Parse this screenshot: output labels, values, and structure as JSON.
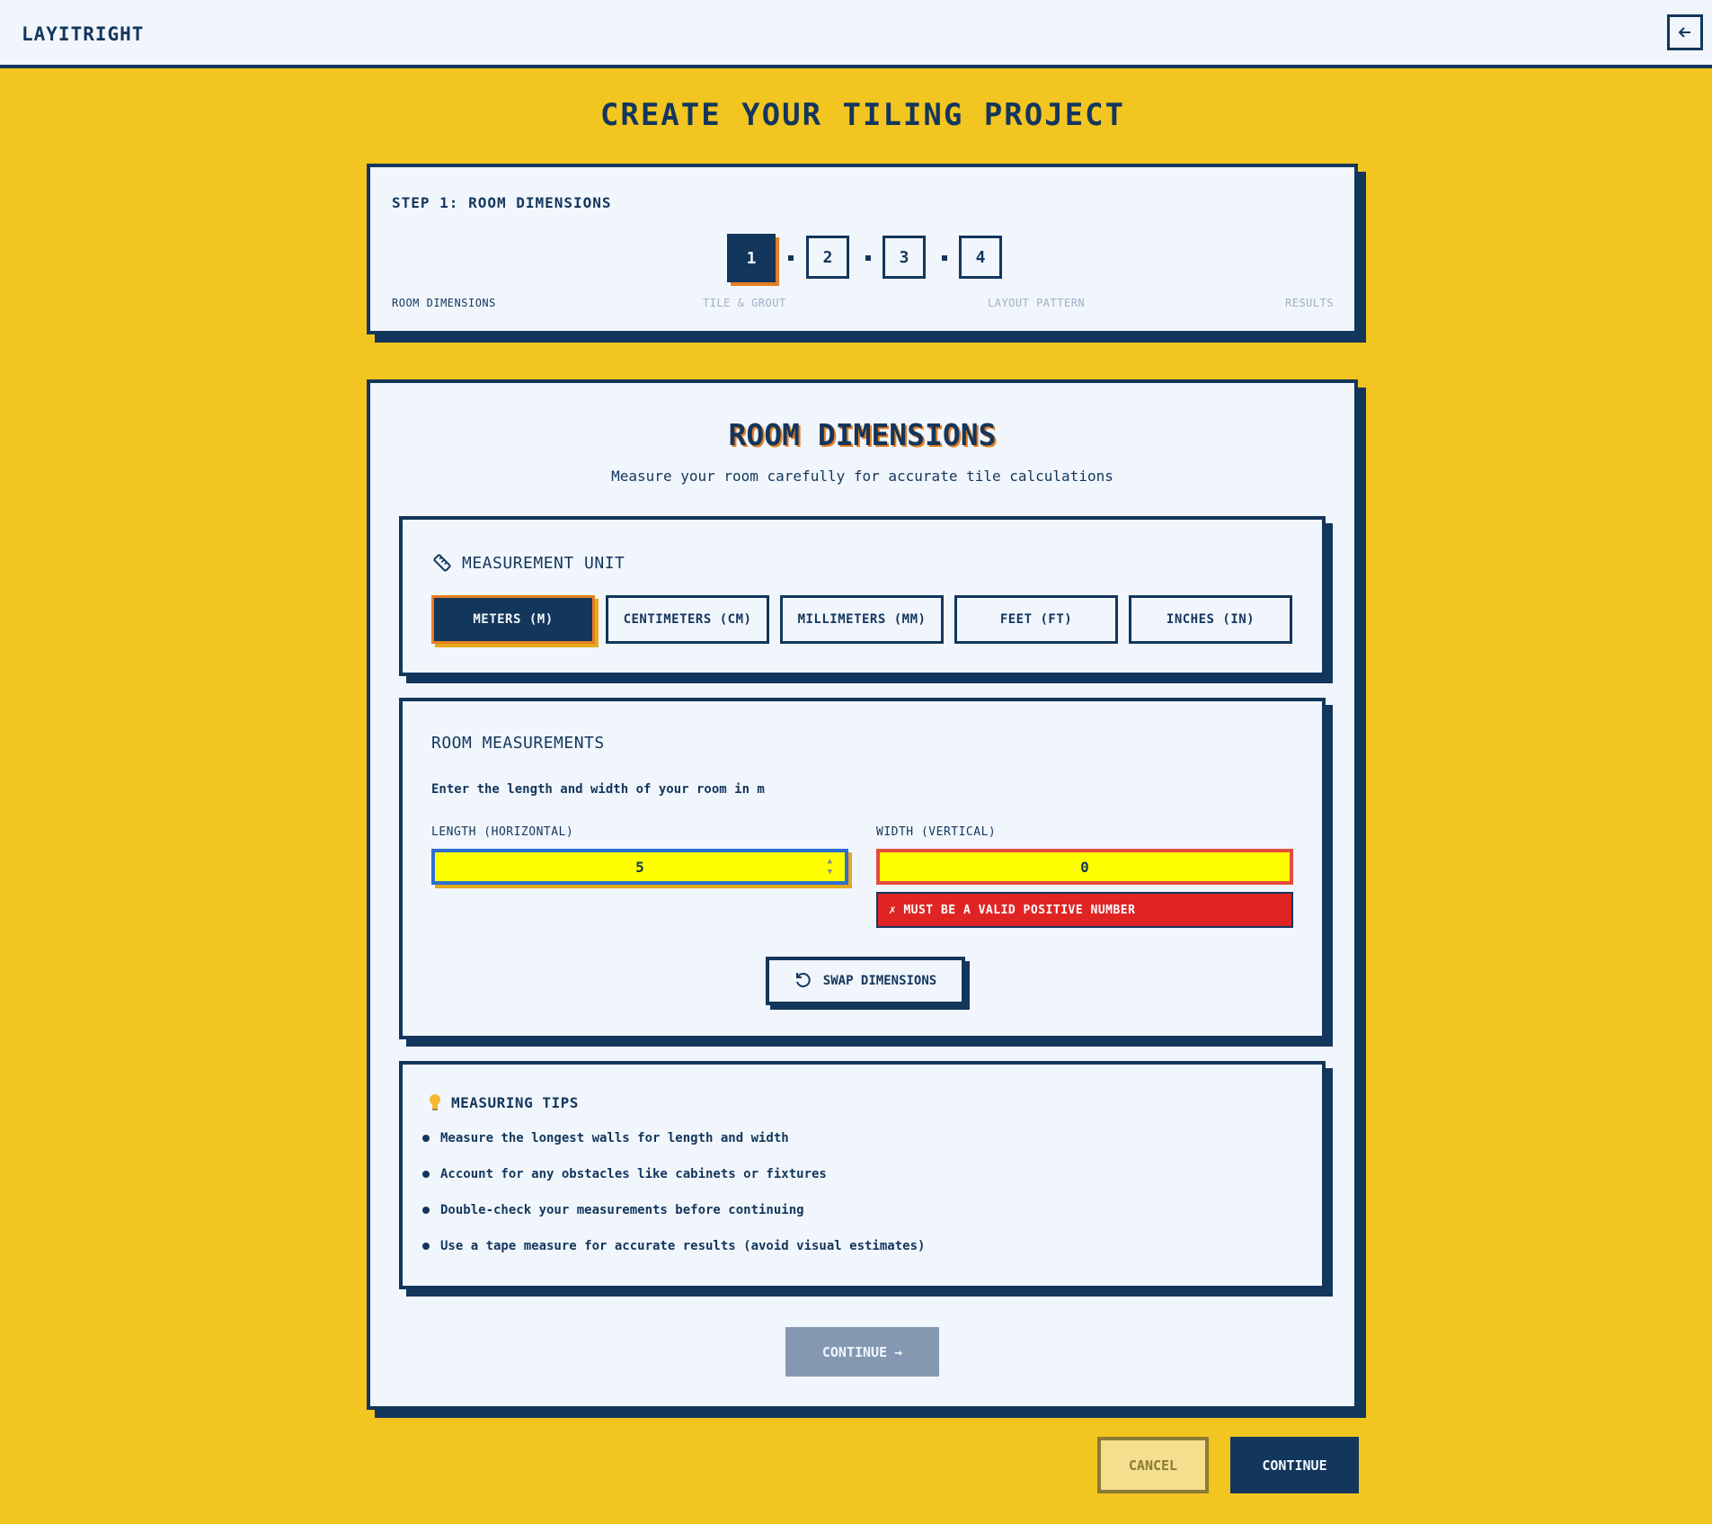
{
  "header": {
    "brand": "LAYITRIGHT",
    "back_icon": "arrow-left-icon"
  },
  "page": {
    "title": "CREATE YOUR TILING PROJECT"
  },
  "stepper": {
    "heading": "STEP 1: ROOM DIMENSIONS",
    "current_step": 1,
    "steps": [
      {
        "number": "1",
        "label": "ROOM DIMENSIONS"
      },
      {
        "number": "2",
        "label": "TILE & GROUT"
      },
      {
        "number": "3",
        "label": "LAYOUT PATTERN"
      },
      {
        "number": "4",
        "label": "RESULTS"
      }
    ]
  },
  "main": {
    "title": "ROOM DIMENSIONS",
    "subtitle": "Measure your room carefully for accurate tile calculations",
    "unit_section": {
      "heading": "MEASUREMENT UNIT",
      "icon": "ruler-icon",
      "selected": "METERS (M)",
      "options": [
        "METERS (M)",
        "CENTIMETERS (CM)",
        "MILLIMETERS (MM)",
        "FEET (FT)",
        "INCHES (IN)"
      ]
    },
    "measurements": {
      "heading": "ROOM MEASUREMENTS",
      "description": "Enter the length and width of your room in m",
      "length_label": "LENGTH (HORIZONTAL)",
      "length_value": "5",
      "width_label": "WIDTH (VERTICAL)",
      "width_value": "0",
      "error_icon": "✗",
      "error": "MUST BE A VALID POSITIVE NUMBER",
      "swap_label": "SWAP DIMENSIONS",
      "swap_icon": "rotate-icon"
    },
    "tips": {
      "heading": "MEASURING TIPS",
      "icon": "lightbulb-icon",
      "items": [
        "Measure the longest walls for length and width",
        "Account for any obstacles like cabinets or fixtures",
        "Double-check your measurements before continuing",
        "Use a tape measure for accurate results (avoid visual estimates)"
      ]
    },
    "continue_label": "CONTINUE",
    "continue_arrow": "→"
  },
  "footer": {
    "cancel_label": "CANCEL",
    "continue_label": "CONTINUE"
  },
  "colors": {
    "background": "#f3c520",
    "navy": "#13365c",
    "accent_orange": "#e67e22",
    "input_yellow": "#ffff00",
    "error_red": "#e02424",
    "disabled": "#8499b1"
  }
}
